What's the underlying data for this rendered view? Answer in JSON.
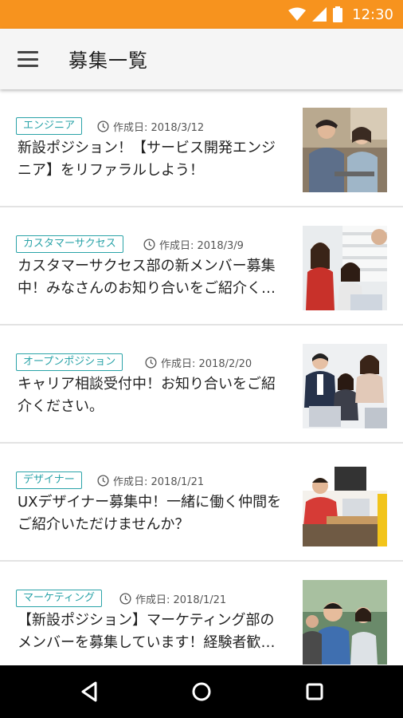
{
  "status_bar": {
    "time": "12:30",
    "icons": [
      "wifi-icon",
      "cell-signal-icon",
      "battery-icon"
    ],
    "background": "#f7931e"
  },
  "app_bar": {
    "title": "募集一覧",
    "menu_icon": "hamburger-menu-icon"
  },
  "accent_color": "#2aa3a8",
  "jobs": [
    {
      "tag": "エンジニア",
      "date": "作成日: 2018/3/12",
      "title": "新設ポジション！【サービス開発エンジニア】をリファラルしよう！"
    },
    {
      "tag": "カスタマーサクセス",
      "date": "作成日: 2018/3/9",
      "title": "カスタマーサクセス部の新メンバー募集中！みなさんのお知り合いをご紹介ください！"
    },
    {
      "tag": "オープンポジション",
      "date": "作成日: 2018/2/20",
      "title": "キャリア相談受付中！お知り合いをご紹介ください。"
    },
    {
      "tag": "デザイナー",
      "date": "作成日: 2018/1/21",
      "title": "UXデザイナー募集中！一緒に働く仲間をご紹介いただけませんか？"
    },
    {
      "tag": "マーケティング",
      "date": "作成日: 2018/1/21",
      "title": "【新設ポジション】マーケティング部のメンバーを募集しています！経験者歓迎！"
    }
  ],
  "nav_bar": {
    "buttons": [
      "back-icon",
      "home-icon",
      "recents-icon"
    ]
  }
}
